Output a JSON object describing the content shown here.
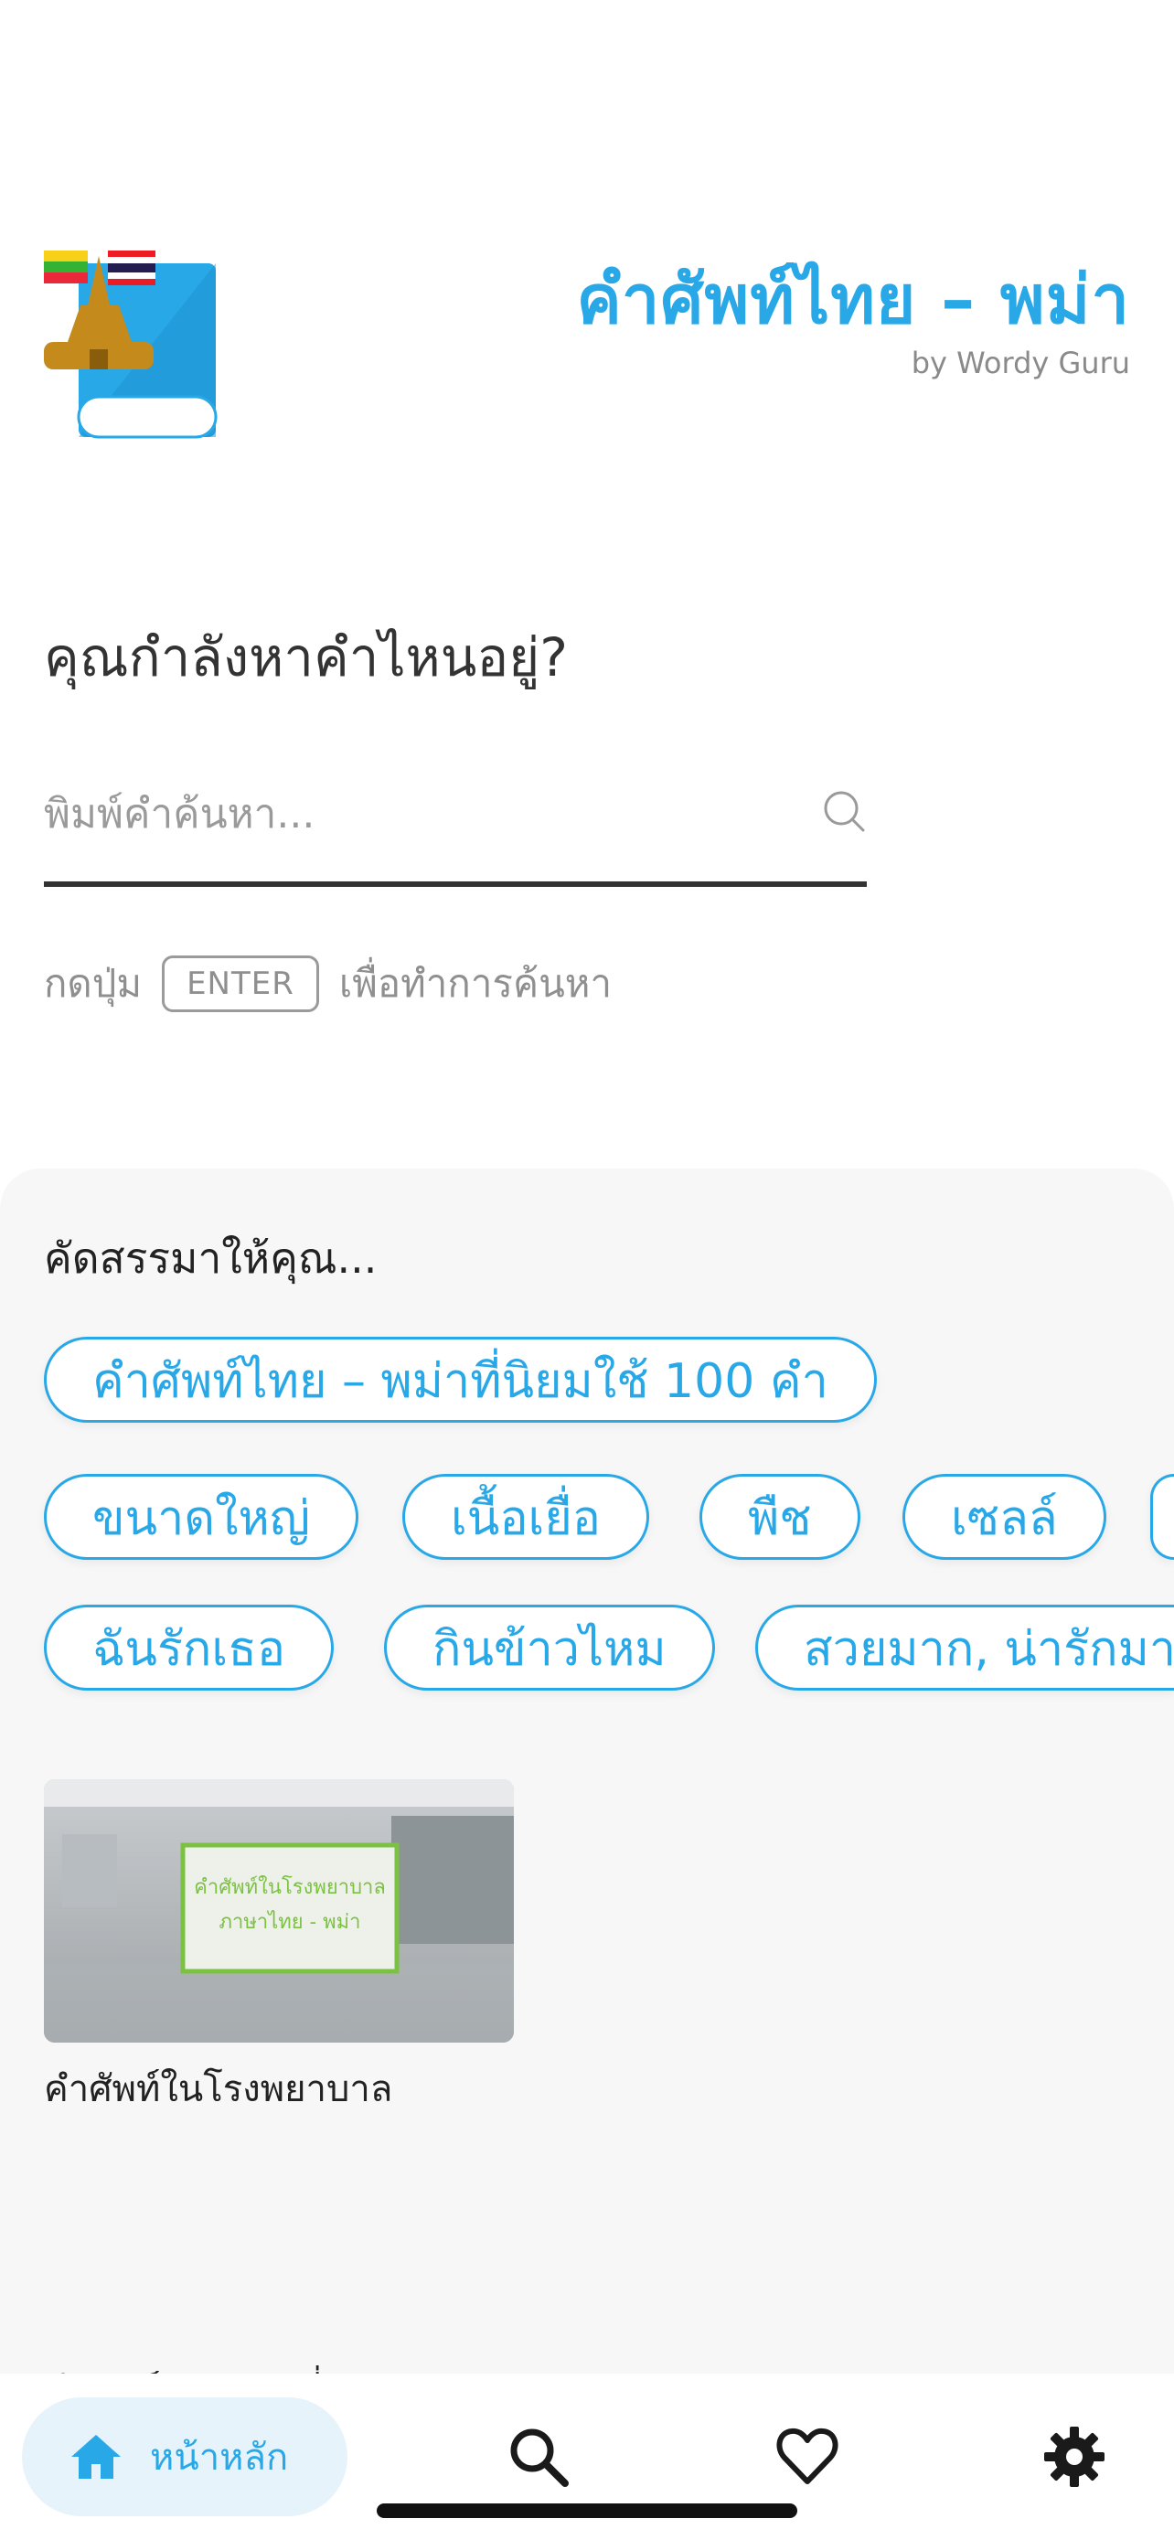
{
  "header": {
    "title": "คำศัพท์ไทย – พม่า",
    "subtitle": "by Wordy Guru",
    "logo_icon": "book-with-flags-logo"
  },
  "search": {
    "question": "คุณกำลังหาคำไหนอยู่?",
    "placeholder": "พิมพ์คำค้นหา...",
    "value": "",
    "hint_before": "กดปุ่ม",
    "hint_key": "ENTER",
    "hint_after": "เพื่อทำการค้นหา"
  },
  "recommended": {
    "title": "คัดสรรมาให้คุณ...",
    "row1": [
      "คำศัพท์ไทย – พม่าที่นิยมใช้ 100 คำ"
    ],
    "row2": [
      "ขนาดใหญ่",
      "เนื้อเยื่อ",
      "พืช",
      "เซลล์"
    ],
    "row3": [
      "ฉันรักเธอ",
      "กินข้าวไหม",
      "สวยมาก, น่ารักมาก"
    ],
    "card": {
      "caption": "คำศัพท์ในโรงพยาบาล",
      "overlay_line1": "คำศัพท์ในโรงพยาบาล",
      "overlay_line2": "ภาษาไทย - พม่า"
    },
    "peek_text": "คำศัพท์ยอดนิยมที่"
  },
  "nav": {
    "home_label": "หน้าหลัก",
    "items": [
      "home-icon",
      "search-icon",
      "heart-icon",
      "settings-icon"
    ]
  },
  "colors": {
    "accent": "#29a8e8",
    "panel_bg": "#f7f7f7",
    "nav_active_bg": "#e6f3fb"
  }
}
